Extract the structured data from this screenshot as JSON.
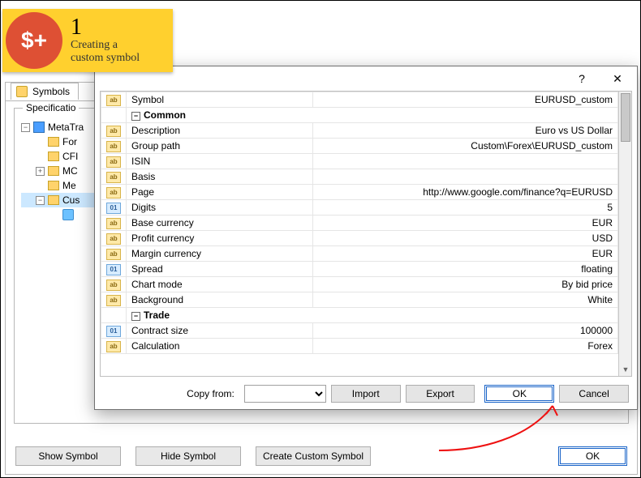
{
  "badge": {
    "icon_text": "$+",
    "number": "1",
    "line1": "Creating a",
    "line2": "custom symbol"
  },
  "back": {
    "tab_label": "Symbols",
    "spec_label": "Specificatio",
    "tree": {
      "root": "MetaTra",
      "n1": "For",
      "n2": "CFI",
      "n3": "MC",
      "n4": "Me",
      "n5": "Cus"
    },
    "buttons": {
      "show": "Show Symbol",
      "hide": "Hide Symbol",
      "create": "Create Custom Symbol",
      "ok": "OK"
    }
  },
  "dialog": {
    "copy_from_label": "Copy from:",
    "import": "Import",
    "export": "Export",
    "ok": "OK",
    "cancel": "Cancel",
    "sections": {
      "common": "Common",
      "trade": "Trade"
    },
    "rows": {
      "symbol_l": "Symbol",
      "symbol_v": "EURUSD_custom",
      "desc_l": "Description",
      "desc_v": "Euro vs US Dollar",
      "gpath_l": "Group path",
      "gpath_v": "Custom\\Forex\\EURUSD_custom",
      "isin_l": "ISIN",
      "isin_v": "",
      "basis_l": "Basis",
      "basis_v": "",
      "page_l": "Page",
      "page_v": "http://www.google.com/finance?q=EURUSD",
      "digits_l": "Digits",
      "digits_v": "5",
      "bcur_l": "Base currency",
      "bcur_v": "EUR",
      "pcur_l": "Profit currency",
      "pcur_v": "USD",
      "mcur_l": "Margin currency",
      "mcur_v": "EUR",
      "spread_l": "Spread",
      "spread_v": "floating",
      "cmode_l": "Chart mode",
      "cmode_v": "By bid price",
      "bg_l": "Background",
      "bg_v": "White",
      "csize_l": "Contract size",
      "csize_v": "100000",
      "calc_l": "Calculation",
      "calc_v": "Forex"
    }
  }
}
